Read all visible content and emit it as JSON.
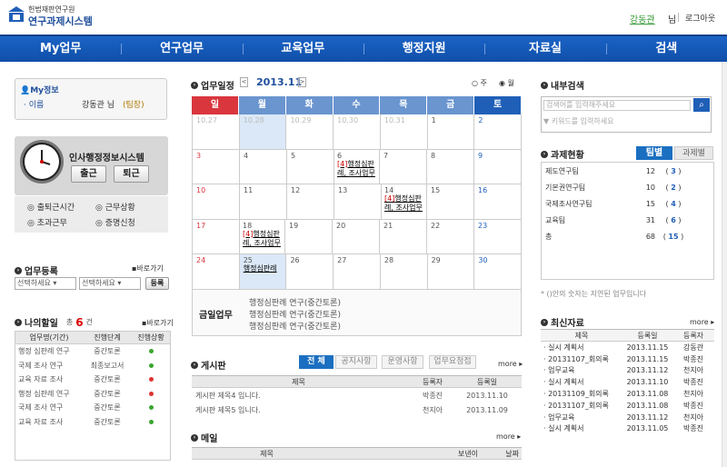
{
  "header": {
    "org_small": "헌법재판연구원",
    "org_big": "연구과제시스템",
    "user_name": "강동관",
    "user_suffix": "님",
    "logout": "로그아웃"
  },
  "nav": [
    "My업무",
    "연구업무",
    "교육업무",
    "행정지원",
    "자료실",
    "검색"
  ],
  "my_info": {
    "title": "My정보",
    "name_label": "· 이름",
    "name_value": "강동관 님",
    "rank": "(팀장)"
  },
  "attendance": {
    "title": "인사행정정보시스템",
    "in_label": "출근",
    "out_label": "퇴근",
    "links": [
      "출퇴근시간",
      "근무상황",
      "초과근무",
      "증명신청"
    ]
  },
  "register": {
    "title": "업무등록",
    "more": "바로가기",
    "select1": "선택하세요",
    "select2": "선택하세요",
    "button": "등록"
  },
  "todo": {
    "title": "나의할일",
    "total_prefix": "총",
    "total_count": "6",
    "total_suffix": "건",
    "more": "바로가기",
    "headers": [
      "업무명(기간)",
      "진행단계",
      "진행상황"
    ],
    "rows": [
      {
        "name": "행정 심판례 연구",
        "stage": "중간토론",
        "status": "green"
      },
      {
        "name": "국제 조사 연구",
        "stage": "최종보고서",
        "status": "green"
      },
      {
        "name": "교육 자료 조사",
        "stage": "중간토론",
        "status": "red"
      },
      {
        "name": "행정 심판례 연구",
        "stage": "중간토론",
        "status": "red"
      },
      {
        "name": "국제 조사 연구",
        "stage": "중간토론",
        "status": "green"
      },
      {
        "name": "교육 자료 조사",
        "stage": "중간토론",
        "status": "green"
      }
    ]
  },
  "calendar": {
    "title": "업무일정",
    "month": "2013.11",
    "prev": "<",
    "next": ">",
    "view_week": "주",
    "view_month": "월",
    "days": [
      "일",
      "월",
      "화",
      "수",
      "목",
      "금",
      "토"
    ],
    "day_colors": [
      "#d9363e",
      "#6a95cf",
      "#6a95cf",
      "#6a95cf",
      "#6a95cf",
      "#6a95cf",
      "#1f5fb8"
    ],
    "weeks": [
      [
        {
          "d": "10.27",
          "muted": true
        },
        {
          "d": "10.28",
          "muted": true,
          "hl": true
        },
        {
          "d": "10.29",
          "muted": true
        },
        {
          "d": "10.30",
          "muted": true
        },
        {
          "d": "10.31",
          "muted": true
        },
        {
          "d": "1"
        },
        {
          "d": "2"
        }
      ],
      [
        {
          "d": "3"
        },
        {
          "d": "4"
        },
        {
          "d": "5"
        },
        {
          "d": "6",
          "ev_num": "[4]",
          "ev": "행정심판례, 조사업무"
        },
        {
          "d": "7"
        },
        {
          "d": "8"
        },
        {
          "d": "9"
        }
      ],
      [
        {
          "d": "10"
        },
        {
          "d": "11"
        },
        {
          "d": "12"
        },
        {
          "d": "13"
        },
        {
          "d": "14",
          "ev_num": "[4]",
          "ev": "행정심판례, 조사업무"
        },
        {
          "d": "15"
        },
        {
          "d": "16"
        }
      ],
      [
        {
          "d": "17"
        },
        {
          "d": "18",
          "ev_num": "[4]",
          "ev": "행정심판례, 조사업무"
        },
        {
          "d": "19"
        },
        {
          "d": "20"
        },
        {
          "d": "21"
        },
        {
          "d": "22"
        },
        {
          "d": "23"
        }
      ],
      [
        {
          "d": "24"
        },
        {
          "d": "25",
          "ev": "행정심판례",
          "hl": true
        },
        {
          "d": "26"
        },
        {
          "d": "27"
        },
        {
          "d": "28"
        },
        {
          "d": "29"
        },
        {
          "d": "30"
        }
      ]
    ],
    "today_label": "금일업무",
    "today_items": [
      "행정심판례 연구(중간토론)",
      "행정심판례 연구(중간토론)",
      "행정심판례 연구(중간토론)"
    ]
  },
  "board": {
    "title": "게시판",
    "tabs": [
      "전 체",
      "공지사항",
      "운영사항",
      "업무요청접"
    ],
    "more": "more",
    "headers": [
      "제목",
      "등록자",
      "등록일"
    ],
    "rows": [
      {
        "title": "게시판 제목4 입니다.",
        "author": "박종진",
        "date": "2013.11.10"
      },
      {
        "title": "게시판 제목5 입니다.",
        "author": "천지아",
        "date": "2013.11.09"
      }
    ]
  },
  "mail": {
    "title": "메일",
    "more": "more",
    "headers": [
      "제목",
      "보낸이",
      "날짜"
    ]
  },
  "search": {
    "title": "내부검색",
    "placeholder": "검색어를 입력해주세요",
    "keyword": "▼ 키워드를 입력하세요"
  },
  "projects": {
    "title": "과제현황",
    "tab_team": "팀별",
    "tab_proj": "과제별",
    "rows": [
      {
        "name": "제도연구팀",
        "total": "12",
        "delay": "3"
      },
      {
        "name": "기본권연구팀",
        "total": "10",
        "delay": "2"
      },
      {
        "name": "국제조사연구팀",
        "total": "15",
        "delay": "4"
      },
      {
        "name": "교육팀",
        "total": "31",
        "delay": "6"
      },
      {
        "name": "총",
        "total": "68",
        "delay": "15"
      }
    ],
    "note": "* ()안의 숫자는 지연된 업무입니다"
  },
  "latest": {
    "title": "최신자료",
    "more": "more",
    "headers": [
      "제목",
      "등록일",
      "등록자"
    ],
    "rows": [
      {
        "title": "실시 계획서",
        "date": "2013.11.15",
        "author": "강동관"
      },
      {
        "title": "20131107_회의록",
        "date": "2013.11.15",
        "author": "박종진"
      },
      {
        "title": "업무교육",
        "date": "2013.11.12",
        "author": "천지아"
      },
      {
        "title": "실시 계획서",
        "date": "2013.11.10",
        "author": "박종진"
      },
      {
        "title": "20131109_회의록",
        "date": "2013.11.08",
        "author": "천지아"
      },
      {
        "title": "20131107_회의록",
        "date": "2013.11.08",
        "author": "박종진"
      },
      {
        "title": "업무교육",
        "date": "2013.11.12",
        "author": "천지아"
      },
      {
        "title": "실시 계획서",
        "date": "2013.11.05",
        "author": "박종진"
      }
    ]
  }
}
